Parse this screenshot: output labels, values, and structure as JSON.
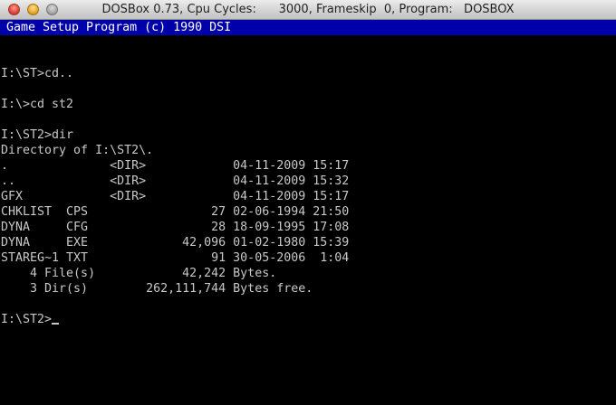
{
  "window": {
    "title": "DOSBox 0.73, Cpu Cycles:      3000, Frameskip  0, Program:   DOSBOX"
  },
  "banner": {
    "text": "Game Setup Program (c) 1990 DSI"
  },
  "console": {
    "lines": [
      "",
      "I:\\ST>cd..",
      "",
      "I:\\>cd st2",
      "",
      "I:\\ST2>dir",
      "Directory of I:\\ST2\\.",
      ".              <DIR>            04-11-2009 15:17",
      "..             <DIR>            04-11-2009 15:32",
      "GFX            <DIR>            04-11-2009 15:17",
      "CHKLIST  CPS                 27 02-06-1994 21:50",
      "DYNA     CFG                 28 18-09-1995 17:08",
      "DYNA     EXE             42,096 01-02-1980 15:39",
      "STAREG~1 TXT                 91 30-05-2006  1:04",
      "    4 File(s)            42,242 Bytes.",
      "    3 Dir(s)        262,111,744 Bytes free.",
      ""
    ],
    "prompt": "I:\\ST2>"
  }
}
